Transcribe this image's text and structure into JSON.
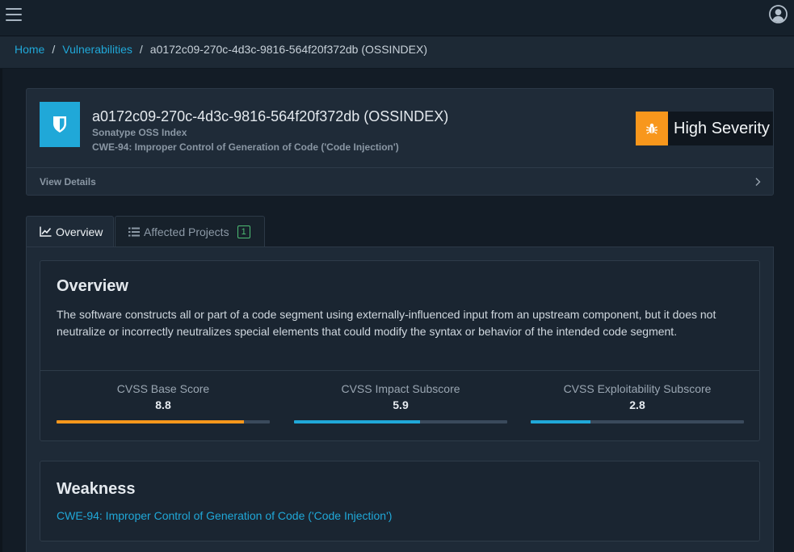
{
  "topbar": {
    "menu_icon": "hamburger-menu-icon",
    "user_icon": "user-circle-icon"
  },
  "breadcrumb": {
    "home": "Home",
    "separator": "/",
    "vulnerabilities": "Vulnerabilities",
    "current": "a0172c09-270c-4d3c-9816-564f20f372db (OSSINDEX)"
  },
  "vulnerability": {
    "icon": "shield-icon",
    "title": "a0172c09-270c-4d3c-9816-564f20f372db (OSSINDEX)",
    "source": "Sonatype OSS Index",
    "cwe": "CWE-94: Improper Control of Generation of Code ('Code Injection')",
    "severity_icon": "bug-icon",
    "severity_label": "High Severity",
    "severity_color": "#f8971c",
    "view_details": "View Details"
  },
  "tabs": [
    {
      "label": "Overview",
      "icon": "chart-line-icon",
      "active": true
    },
    {
      "label": "Affected Projects",
      "icon": "list-icon",
      "badge": "1",
      "active": false
    }
  ],
  "overview": {
    "heading": "Overview",
    "description": "The software constructs all or part of a code segment using externally-influenced input from an upstream component, but it does not neutralize or incorrectly neutralizes special elements that could modify the syntax or behavior of the intended code segment.",
    "scores": [
      {
        "label": "CVSS Base Score",
        "value": "8.8",
        "percent": 88,
        "color": "#f8971c"
      },
      {
        "label": "CVSS Impact Subscore",
        "value": "5.9",
        "percent": 59,
        "color": "#20a8d8"
      },
      {
        "label": "CVSS Exploitability Subscore",
        "value": "2.8",
        "percent": 28,
        "color": "#20a8d8"
      }
    ]
  },
  "weakness": {
    "heading": "Weakness",
    "link": "CWE-94: Improper Control of Generation of Code ('Code Injection')"
  }
}
